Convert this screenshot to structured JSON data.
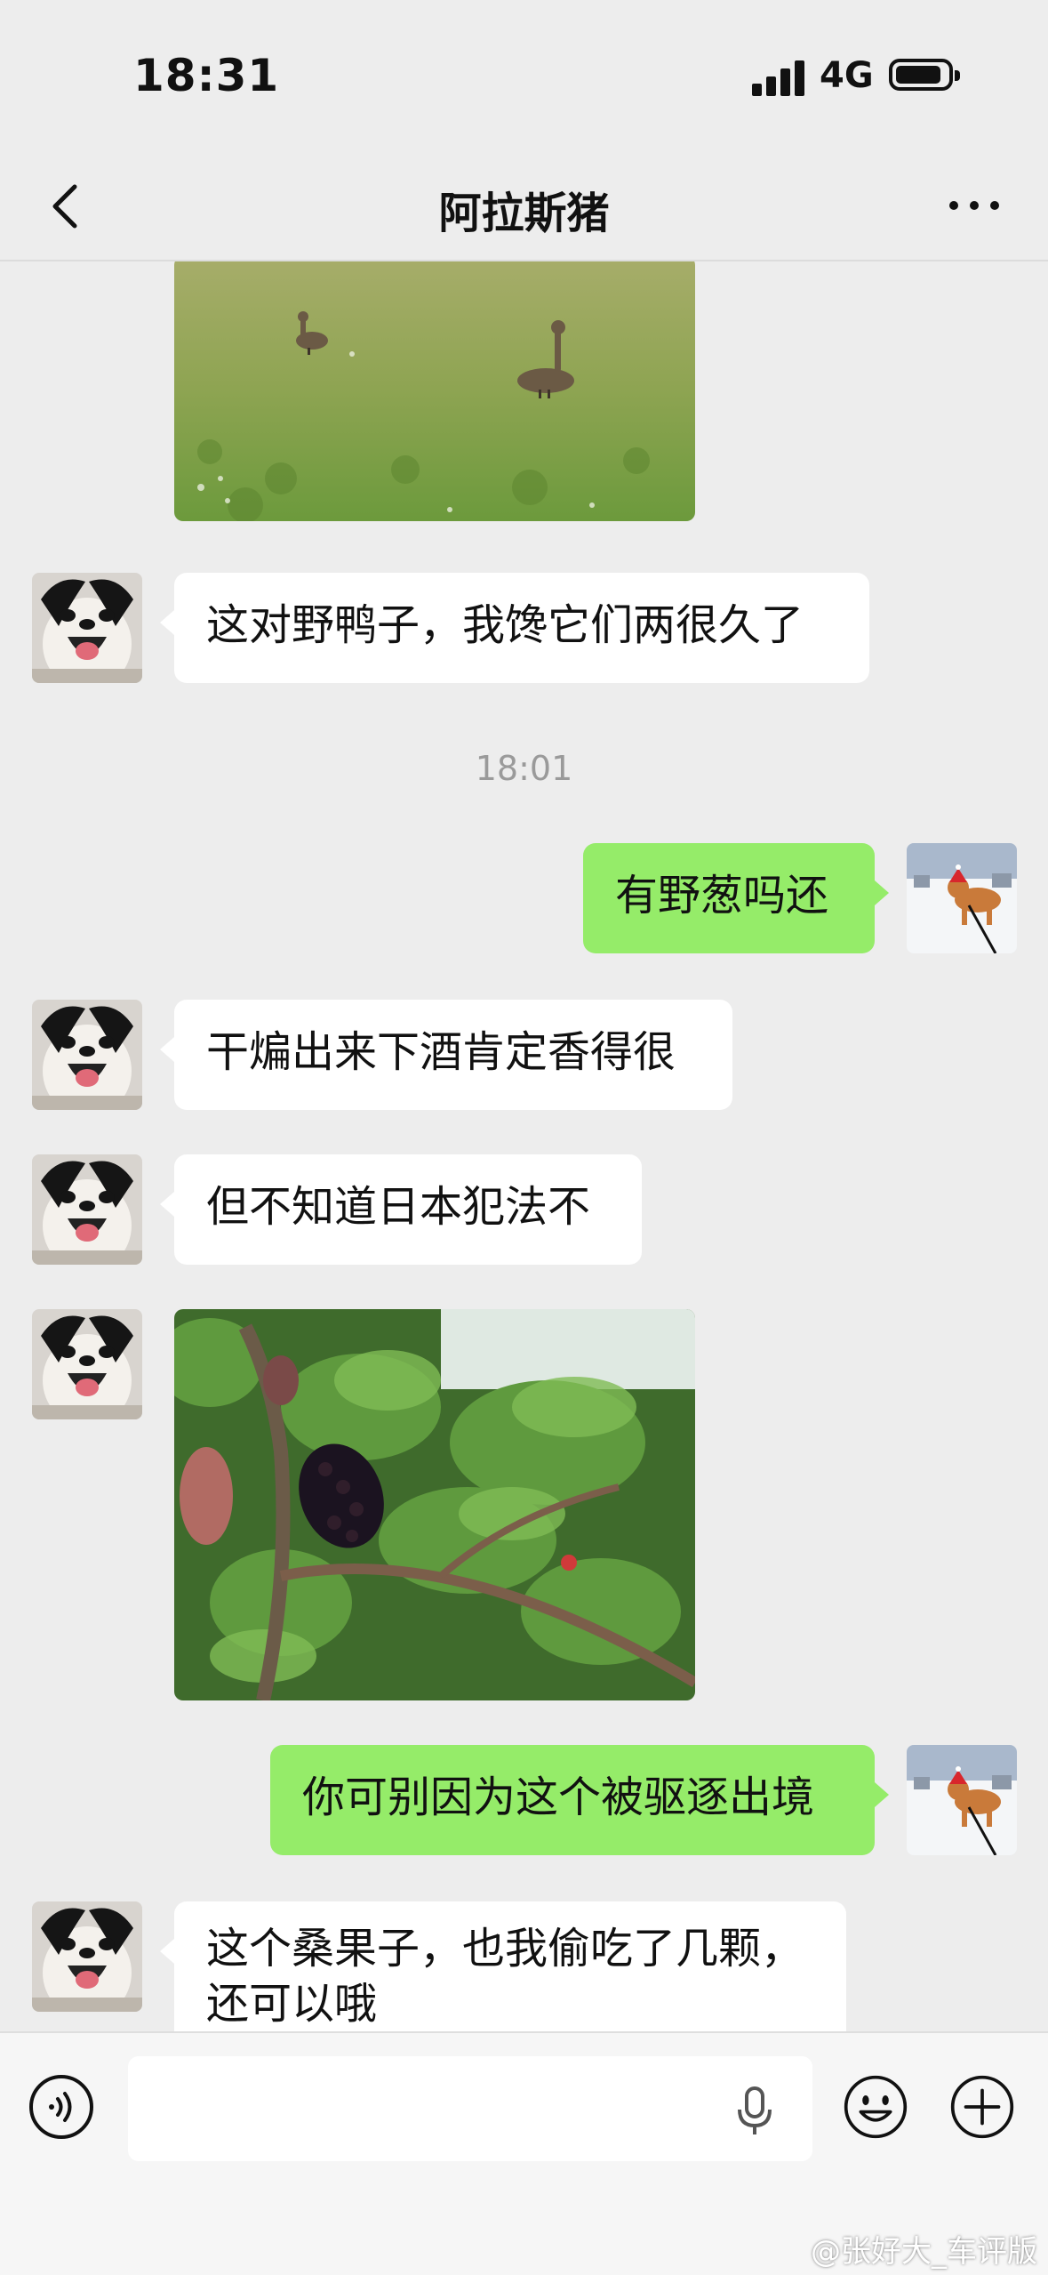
{
  "status_bar": {
    "time": "18:31",
    "network": "4G",
    "battery_icon": "battery-icon"
  },
  "nav": {
    "title": "阿拉斯猪",
    "back_icon": "chevron-left-icon",
    "more_icon": "more-icon"
  },
  "messages": [
    {
      "type": "image",
      "sender": "other",
      "description_icon": "duck-photo"
    },
    {
      "type": "text",
      "sender": "other",
      "text": "这对野鸭子，我馋它们两很久了"
    },
    {
      "type": "timestamp",
      "text": "18:01"
    },
    {
      "type": "text",
      "sender": "me",
      "text": "有野葱吗还"
    },
    {
      "type": "text",
      "sender": "other",
      "text": "干煸出来下酒肯定香得很"
    },
    {
      "type": "text",
      "sender": "other",
      "text": "但不知道日本犯法不"
    },
    {
      "type": "image",
      "sender": "other",
      "description_icon": "mulberry-photo"
    },
    {
      "type": "text",
      "sender": "me",
      "text": "你可别因为这个被驱逐出境"
    },
    {
      "type": "text",
      "sender": "other",
      "text_lines": [
        "这个桑果子，也我偷吃了几颗，",
        "还可以哦"
      ]
    }
  ],
  "input_bar": {
    "voice_icon": "voice-icon",
    "mic_icon": "microphone-icon",
    "emoji_icon": "emoji-icon",
    "plus_icon": "plus-icon",
    "placeholder": ""
  },
  "watermark": "@张好大_车评版",
  "colors": {
    "background": "#ededed",
    "outgoing_bubble": "#95ec69",
    "incoming_bubble": "#ffffff"
  }
}
